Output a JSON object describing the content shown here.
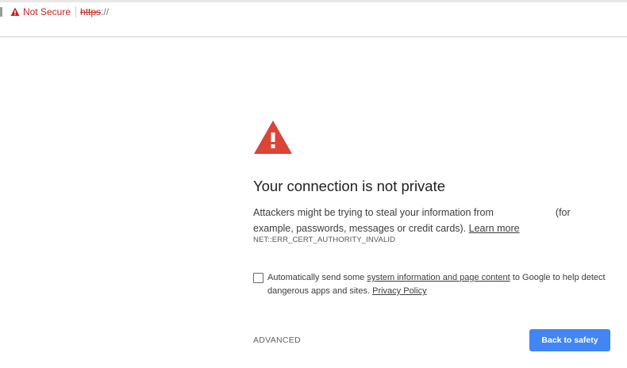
{
  "address_bar": {
    "security_label": "Not Secure",
    "url_scheme": "https",
    "url_rest": "://",
    "colors": {
      "warning_red": "#c5221f"
    }
  },
  "interstitial": {
    "icon": "warning-triangle-icon",
    "heading": "Your connection is not private",
    "body_part1": "Attackers might be trying to steal your information from",
    "body_part2": "(for example, passwords, messages or credit cards).",
    "learn_more": "Learn more",
    "error_code": "NET::ERR_CERT_AUTHORITY_INVALID",
    "checkbox": {
      "checked": false,
      "text_before": "Automatically send some",
      "link1": "system information and page content",
      "text_middle": "to Google to help detect dangerous apps and sites.",
      "link2": "Privacy Policy"
    },
    "advanced_label": "ADVANCED",
    "back_button_label": "Back to safety",
    "colors": {
      "icon_red": "#db4437",
      "button_blue": "#4285f4"
    }
  }
}
